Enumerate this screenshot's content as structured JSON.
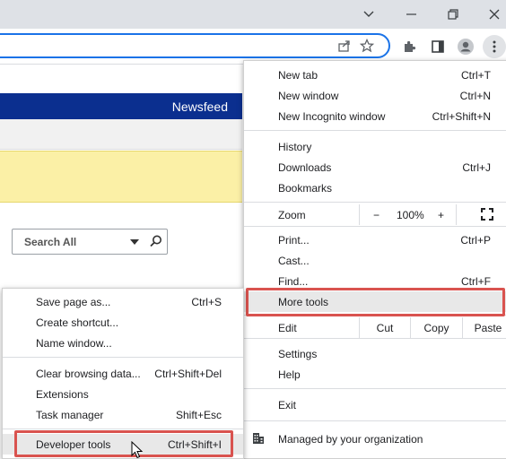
{
  "window": {
    "buttons": [
      {
        "name": "tab-search"
      },
      {
        "name": "minimize"
      },
      {
        "name": "restore"
      },
      {
        "name": "close"
      }
    ]
  },
  "toolbar": {
    "icons": [
      "share-icon",
      "bookmark-star-icon",
      "extensions-icon",
      "side-panel-icon",
      "profile-icon",
      "chrome-menu-icon"
    ]
  },
  "page": {
    "newsfeed": "Newsfeed",
    "search_placeholder": "Search All"
  },
  "main_menu": {
    "new_tab": {
      "label": "New tab",
      "shortcut": "Ctrl+T"
    },
    "new_window": {
      "label": "New window",
      "shortcut": "Ctrl+N"
    },
    "new_incognito": {
      "label": "New Incognito window",
      "shortcut": "Ctrl+Shift+N"
    },
    "history": {
      "label": "History"
    },
    "downloads": {
      "label": "Downloads",
      "shortcut": "Ctrl+J"
    },
    "bookmarks": {
      "label": "Bookmarks"
    },
    "zoom": {
      "label": "Zoom",
      "minus": "−",
      "value": "100%",
      "plus": "+"
    },
    "print": {
      "label": "Print...",
      "shortcut": "Ctrl+P"
    },
    "cast": {
      "label": "Cast..."
    },
    "find": {
      "label": "Find...",
      "shortcut": "Ctrl+F"
    },
    "more_tools": {
      "label": "More tools"
    },
    "edit": {
      "label": "Edit",
      "cut": "Cut",
      "copy": "Copy",
      "paste": "Paste"
    },
    "settings": {
      "label": "Settings"
    },
    "help": {
      "label": "Help"
    },
    "exit": {
      "label": "Exit"
    },
    "managed": {
      "label": "Managed by your organization"
    }
  },
  "sub_menu": {
    "save_page": {
      "label": "Save page as...",
      "shortcut": "Ctrl+S"
    },
    "create_shortcut": {
      "label": "Create shortcut..."
    },
    "name_window": {
      "label": "Name window..."
    },
    "clear_data": {
      "label": "Clear browsing data...",
      "shortcut": "Ctrl+Shift+Del"
    },
    "extensions": {
      "label": "Extensions"
    },
    "task_manager": {
      "label": "Task manager",
      "shortcut": "Shift+Esc"
    },
    "developer_tools": {
      "label": "Developer tools",
      "shortcut": "Ctrl+Shift+I"
    }
  },
  "colors": {
    "accent": "#1a73e8",
    "header_blue": "#0b2f8f",
    "highlight_red": "#d9534f",
    "notice_yellow": "#fbf0a6"
  }
}
